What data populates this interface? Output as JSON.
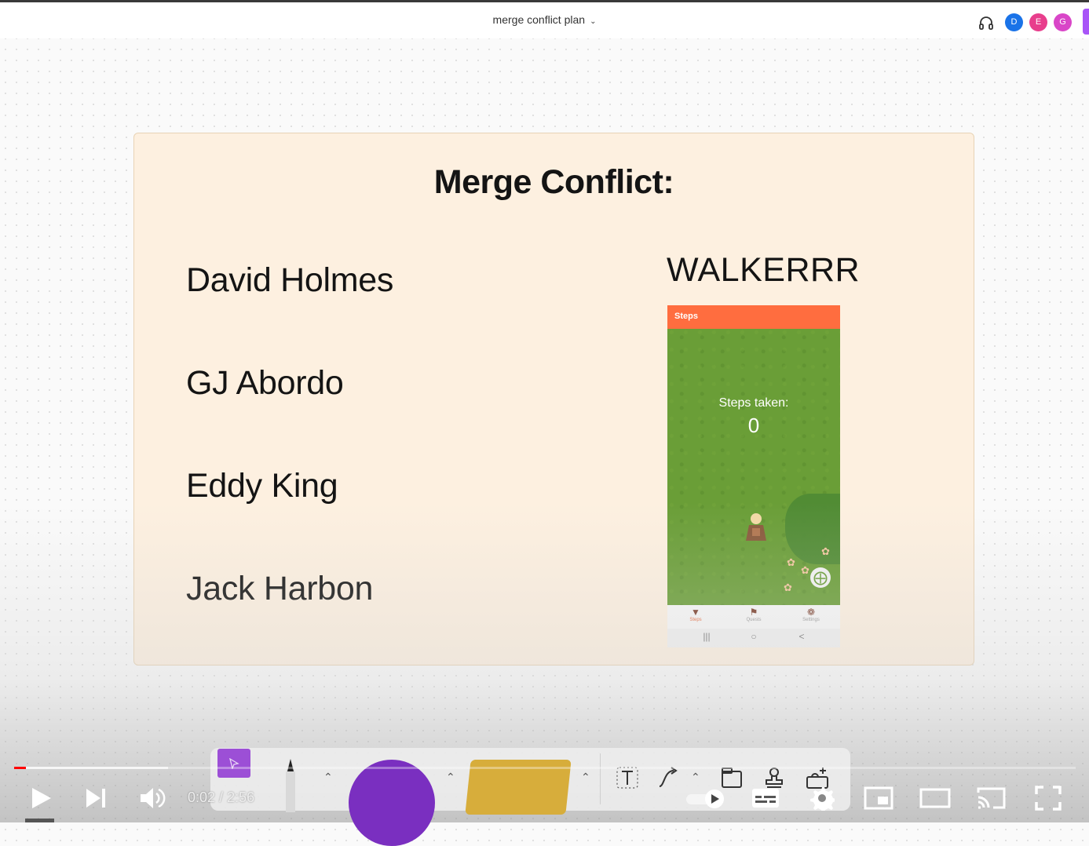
{
  "board": {
    "title": "merge conflict plan",
    "collaborators": [
      {
        "initial": "D",
        "color": "#1a73e8"
      },
      {
        "initial": "E",
        "color": "#e83e8c"
      },
      {
        "initial": "G",
        "color": "#d946c8"
      }
    ]
  },
  "slide": {
    "title": "Merge Conflict:",
    "members": [
      "David Holmes",
      "GJ Abordo",
      "Eddy King",
      "Jack Harbon"
    ],
    "app_name": "WALKERRR",
    "phone": {
      "appbar_title": "Steps",
      "steps_label": "Steps taken:",
      "steps_value": "0",
      "nav": [
        "Steps",
        "Quests",
        "Settings"
      ]
    }
  },
  "player": {
    "current_time": "0:02",
    "duration": "2:56",
    "time_separator": "/",
    "progress": 0.011,
    "buffered": 0.145,
    "accent": "#ff0000"
  },
  "icons": {
    "headphones": "headphones-icon",
    "play": "play-icon",
    "next": "next-icon",
    "volume": "volume-icon",
    "autoplay": "autoplay-toggle-icon",
    "captions": "captions-icon",
    "settings": "gear-icon",
    "miniplayer": "miniplayer-icon",
    "theater": "theater-mode-icon",
    "cast": "cast-icon",
    "fullscreen": "fullscreen-icon"
  }
}
